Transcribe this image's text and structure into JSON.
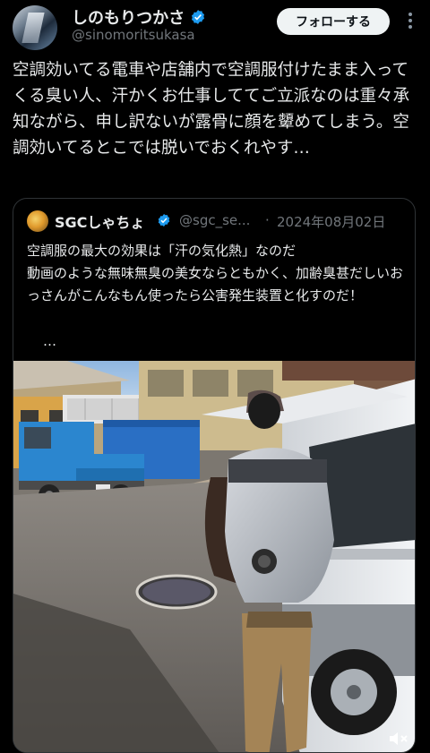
{
  "author": {
    "display_name": "しのもりつかさ",
    "handle": "@sinomoritsukasa"
  },
  "header": {
    "follow_label": "フォローする",
    "more_icon": "more-vertical-icon"
  },
  "tweet": {
    "text": "空調効いてる電車や店舗内で空調服付けたまま入ってくる臭い人、汗かくお仕事しててご立派なのは重々承知ながら、申し訳ないが露骨に顔を顰めてしまう。空調効いてるとこでは脱いでおくれやす…"
  },
  "quote": {
    "display_name": "SGCしゃちょ",
    "handle": "@sgc_se...",
    "separator": "·",
    "date": "2024年08月02日",
    "text": "空調服の最大の効果は「汗の気化熱」なのだ\n動画のような無味無臭の美女ならともかく、加齢臭甚だしいおっさんがこんなもん使ったら公害発生装置と化すのだ！",
    "ellipsis": "…",
    "media_icon": "volume-mute-icon"
  },
  "colors": {
    "background": "#000000",
    "text": "#e7e9ea",
    "secondary_text": "#71767b",
    "verified_blue": "#1d9bf0",
    "border": "#2f3336",
    "follow_button_bg": "#eff3f4"
  }
}
